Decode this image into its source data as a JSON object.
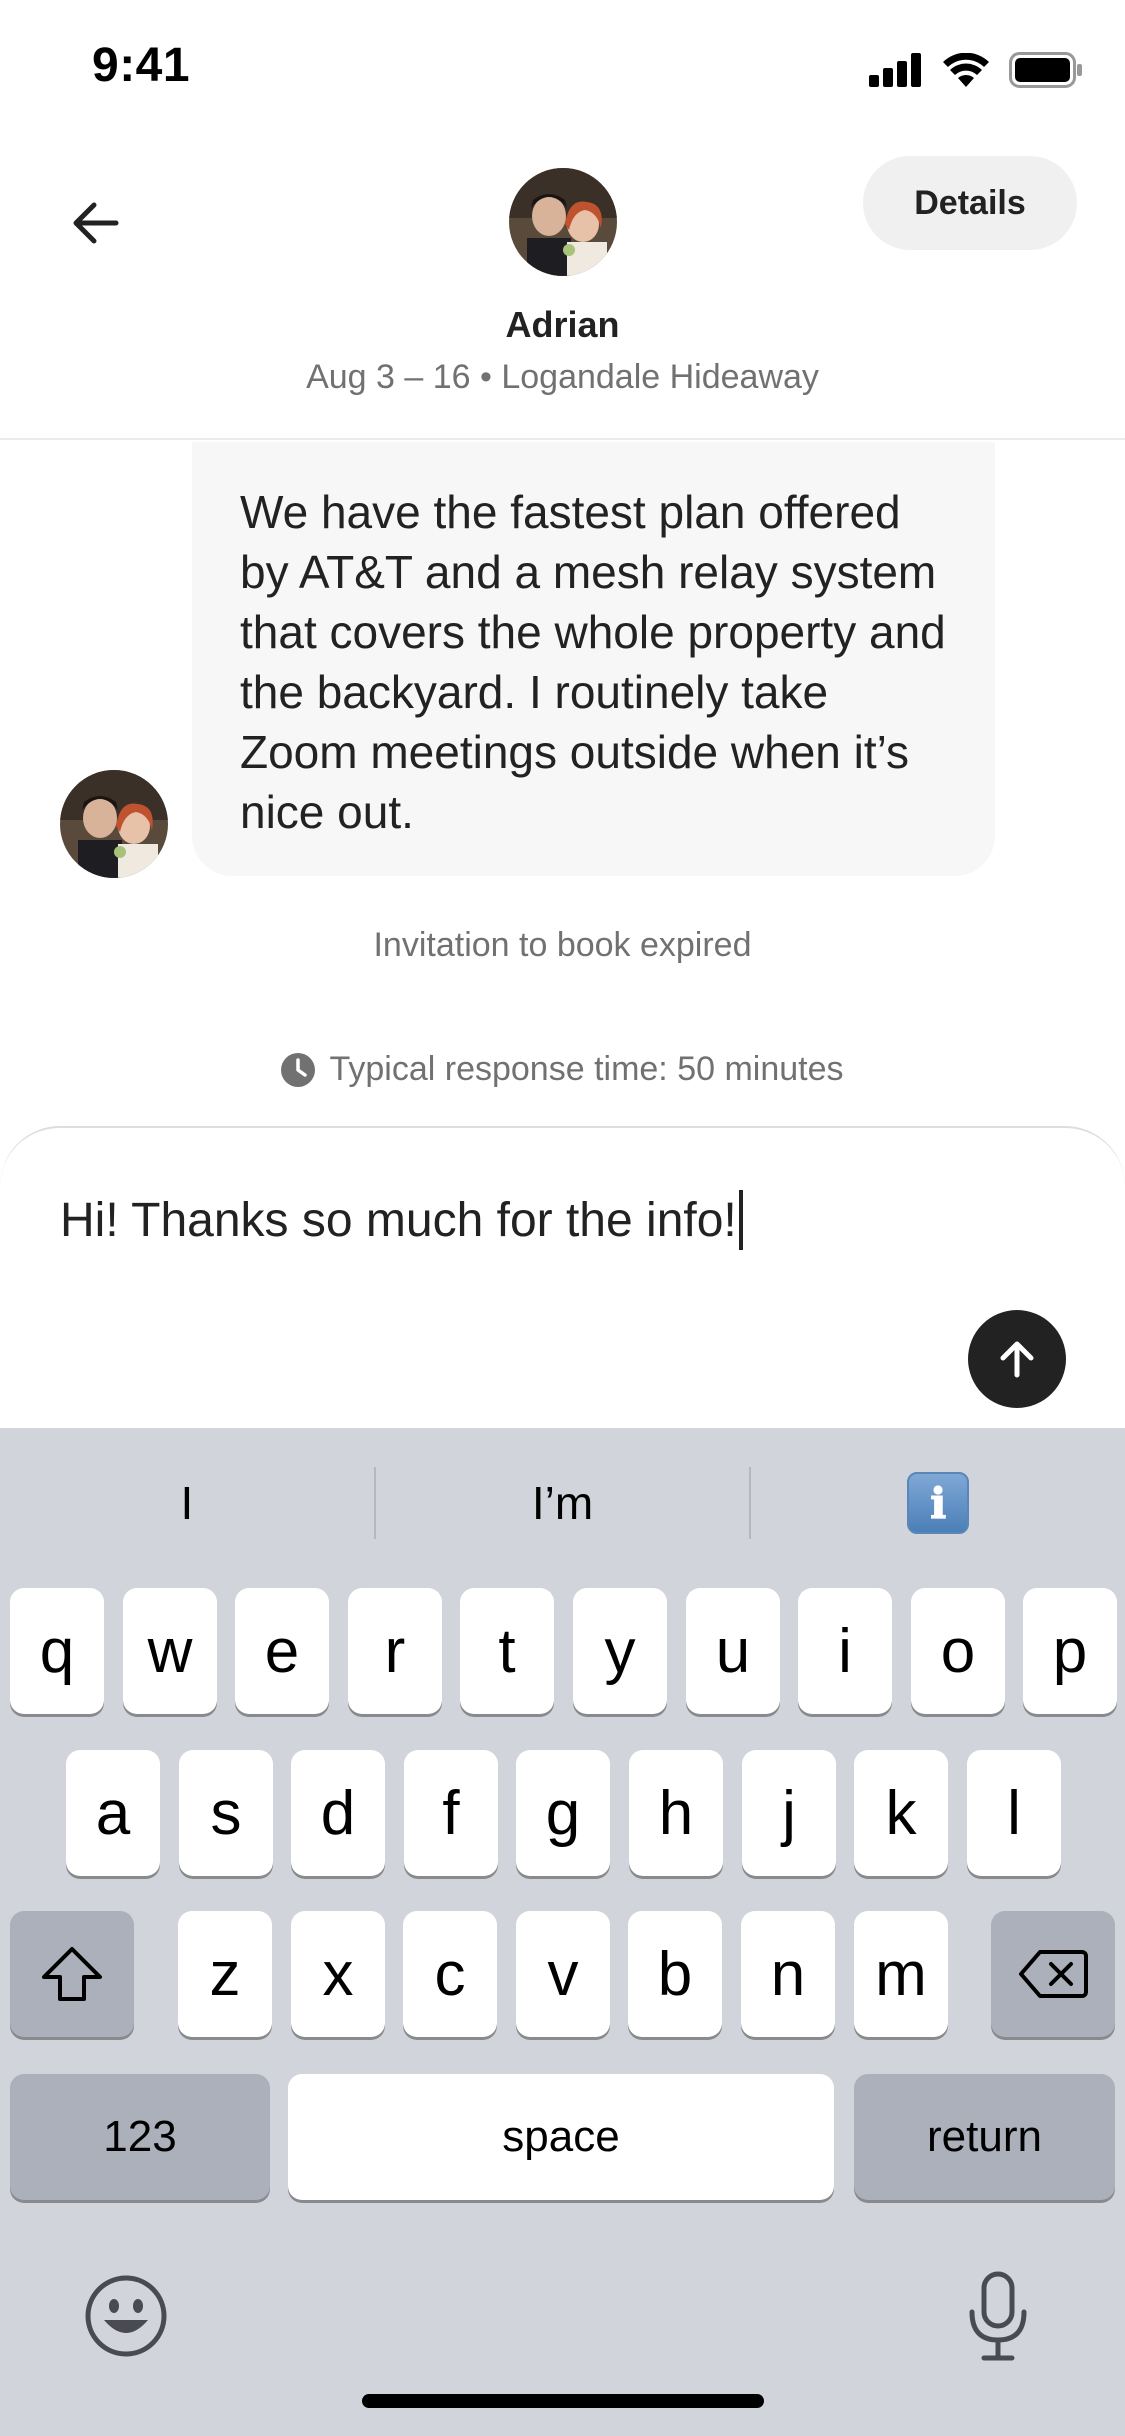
{
  "status_bar": {
    "time": "9:41"
  },
  "header": {
    "details_label": "Details",
    "host_name": "Adrian",
    "trip_info": "Aug 3 – 16 • Logandale Hideaway"
  },
  "messages": {
    "host_message": "We have the fastest plan offered by AT&T and a mesh relay system that covers the whole property and the backyard. I routinely take Zoom meetings outside when it’s nice out.",
    "expired_note": "Invitation to book expired",
    "response_time": "Typical response time: 50 minutes"
  },
  "composer": {
    "draft_text": "Hi! Thanks so much for the info!"
  },
  "keyboard": {
    "suggestions": [
      "I",
      "I’m",
      "ℹ"
    ],
    "row1": [
      "q",
      "w",
      "e",
      "r",
      "t",
      "y",
      "u",
      "i",
      "o",
      "p"
    ],
    "row2": [
      "a",
      "s",
      "d",
      "f",
      "g",
      "h",
      "j",
      "k",
      "l"
    ],
    "row3": [
      "z",
      "x",
      "c",
      "v",
      "b",
      "n",
      "m"
    ],
    "numbers_label": "123",
    "space_label": "space",
    "return_label": "return"
  },
  "colors": {
    "text_primary": "#222222",
    "text_secondary": "#717171",
    "bubble_bg": "#f7f7f7",
    "keyboard_bg": "#d1d4db",
    "send_button": "#222222"
  }
}
